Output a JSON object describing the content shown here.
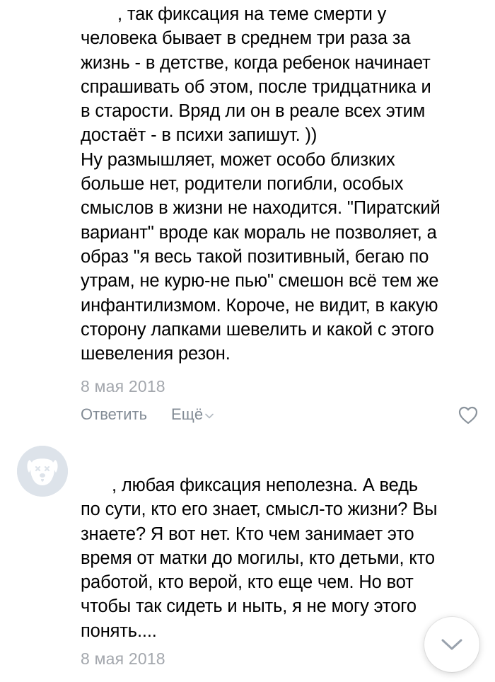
{
  "comments": [
    {
      "lines": [
        ", так фиксация на теме смерти у",
        "человека бывает в среднем три раза за",
        "жизнь - в детстве, когда ребенок начинает",
        "спрашивать об этом, после тридцатника и",
        "в старости. Вряд ли он в реале всех этим",
        "достаёт - в психи запишут. ))",
        "Ну размышляет, может особо близких",
        "больше нет, родители погибли, особых",
        "смыслов в жизни не находится. \"Пиратский",
        "вариант\" вроде как мораль не позволяет, а",
        "образ \"я весь такой позитивный, бегаю по",
        "утрам, не курю-не пью\" смешон всё тем же",
        "инфантилизмом. Короче, не видит, в какую",
        "сторону лапками шевелить и какой с этого",
        "шевеления резон."
      ],
      "date": "8 мая 2018",
      "reply_label": "Ответить",
      "more_label": "Ещё"
    },
    {
      "lines": [
        ", любая фиксация неполезна. А ведь",
        "по сути, кто его знает, смысл-то жизни? Вы",
        "знаете? Я вот нет. Кто чем занимает это",
        "время от матки до могилы, кто детьми, кто",
        "работой, кто верой, кто еще чем. Но вот",
        "чтобы так сидеть и ныть, я не могу этого",
        "понять...."
      ],
      "date": "8 мая 2018"
    }
  ],
  "colors": {
    "text": "#000000",
    "date": "#a3a7ad",
    "action": "#828b95",
    "avatar_bg": "#dde3ea",
    "avatar_fg": "#ffffff"
  },
  "icons": {
    "like": "heart-outline-icon",
    "more": "chevron-down-icon",
    "avatar": "deactivated-dog-icon",
    "scroll": "chevron-down-icon"
  }
}
